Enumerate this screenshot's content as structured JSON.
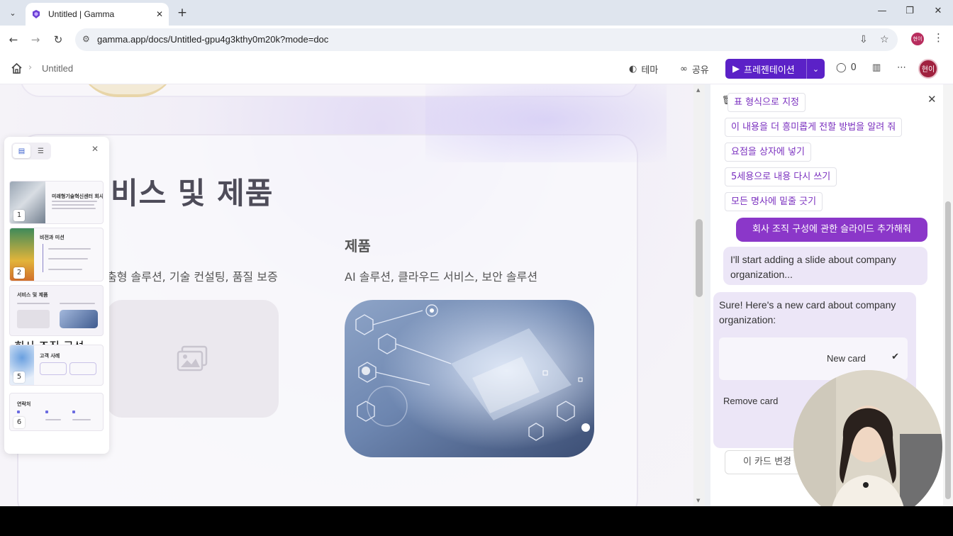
{
  "browser": {
    "tab_title": "Untitled | Gamma",
    "url": "gamma.app/docs/Untitled-gpu4g3kthy0m20k?mode=doc",
    "profile_initials": "현이"
  },
  "header": {
    "breadcrumb_title": "Untitled",
    "theme_label": "테마",
    "share_label": "공유",
    "present_label": "프레젠테이션",
    "comment_count": "0",
    "avatar_initials": "현이"
  },
  "card": {
    "title": "비스 및 제품",
    "left_text": "춤형 솔루션, 기술 컨설팅, 품질 보증",
    "right_heading": "제품",
    "right_text": "AI 솔루션, 클라우드 서비스, 보안 솔루션"
  },
  "thumbnails": [
    {
      "number": "1",
      "title": "미래형기술혁신센터 회사소개"
    },
    {
      "number": "2",
      "title": "비전과 미션"
    },
    {
      "number": "",
      "title": "서비스 및 제품"
    },
    {
      "number": "",
      "title": "회사 조직 구성"
    },
    {
      "number": "5",
      "title": "고객 사례"
    },
    {
      "number": "6",
      "title": "연락처"
    }
  ],
  "chat": {
    "suggestions": [
      "표 형식으로 지정",
      "이 내용을 더 흥미롭게 전할 방법을 알려 줘",
      "요점을 상자에 넣기",
      "5세용으로 내용 다시 쓰기",
      "모든 명사에 밑줄 긋기"
    ],
    "user_message": "회사 조직 구성에 관한 슬라이드 추가해줘",
    "ai_message_1": "I'll start adding a slide about company organization...",
    "ai_message_2": "Sure! Here's a new card about company organization:",
    "option_new": "New card",
    "option_remove": "Remove card",
    "change_button": "이 카드 변경"
  },
  "colors": {
    "accent": "#5b21c7",
    "user_bubble": "#8b37c9",
    "ai_bubble": "#ece6f7",
    "suggestion_text": "#7a2fbf"
  }
}
